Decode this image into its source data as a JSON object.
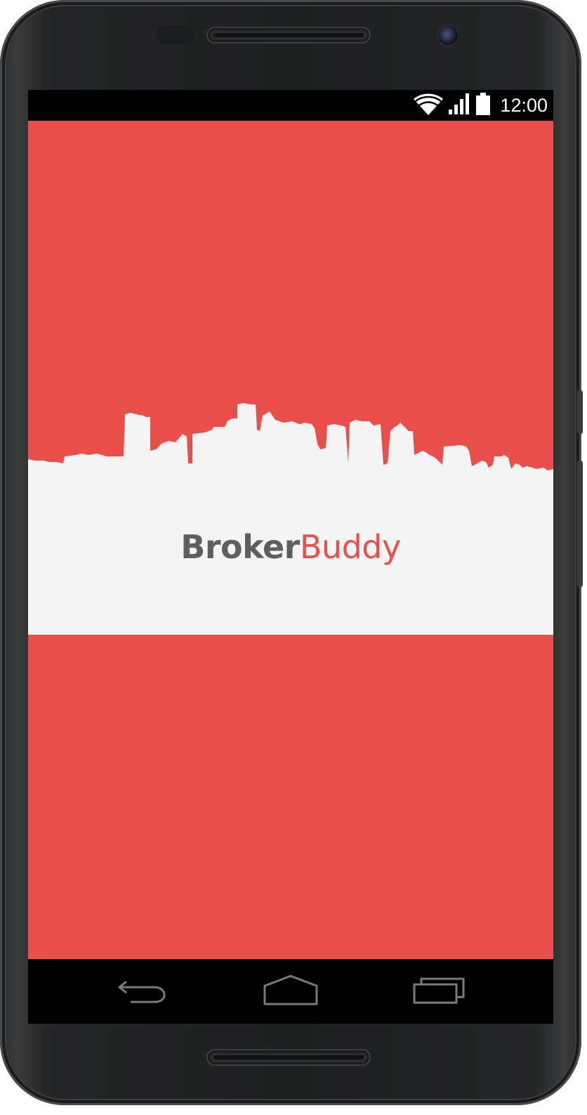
{
  "status_bar": {
    "time": "12:00",
    "icons": [
      "wifi-icon",
      "cell-signal-icon",
      "battery-icon"
    ]
  },
  "app": {
    "logo_part1": "Broker",
    "logo_part2": "Buddy",
    "colors": {
      "primary": "#e9504b",
      "band": "#f5f5f6",
      "logo_dark": "#5f5f60"
    }
  },
  "nav_bar": {
    "buttons": [
      "back-icon",
      "home-icon",
      "recents-icon"
    ]
  }
}
